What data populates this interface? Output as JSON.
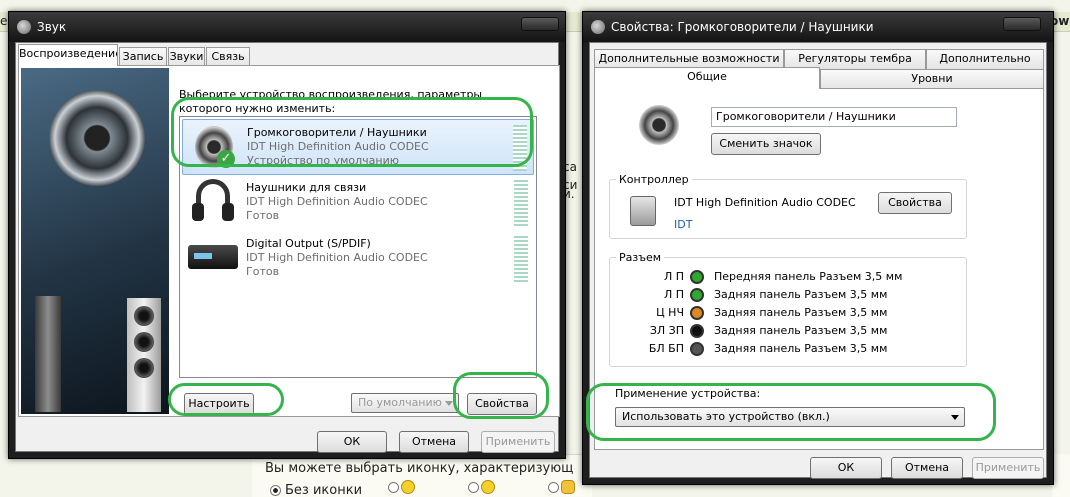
{
  "background": {
    "frag_left": "e",
    "frag_right": "ow",
    "frag_mid1": "ca",
    "frag_mid2": "си",
    "frag_mid3": "и.",
    "prompt_text": "Вы можете выбрать иконку, характеризующ",
    "radio_label": "Без иконки"
  },
  "sound_window": {
    "title": "Звук",
    "tabs": [
      "Воспроизведение",
      "Запись",
      "Звуки",
      "Связь"
    ],
    "instruction": "Выберите устройство воспроизведения, параметры которого нужно изменить:",
    "devices": [
      {
        "name": "Громкоговорители / Наушники",
        "codec": "IDT High Definition Audio CODEC",
        "status": "Устройство по умолчанию",
        "icon": "speaker-icon"
      },
      {
        "name": "Наушники для связи",
        "codec": "IDT High Definition Audio CODEC",
        "status": "Готов",
        "icon": "headset-icon"
      },
      {
        "name": "Digital Output (S/PDIF)",
        "codec": "IDT High Definition Audio CODEC",
        "status": "Готов",
        "icon": "digital-output-icon"
      }
    ],
    "configure_button": "Настроить",
    "default_select": "По умолчанию",
    "properties_button": "Свойства",
    "ok_button": "ОК",
    "cancel_button": "Отмена",
    "apply_button": "Применить"
  },
  "props_window": {
    "title": "Свойства: Громкоговорители / Наушники",
    "tabs_top": [
      "Дополнительные возможности",
      "Регуляторы тембра",
      "Дополнительно"
    ],
    "tabs_bottom": [
      "Общие",
      "Уровни"
    ],
    "device_name": "Громкоговорители / Наушники",
    "change_icon_button": "Сменить значок",
    "controller_group": "Контроллер",
    "controller_name": "IDT High Definition Audio CODEC",
    "controller_link": "IDT",
    "controller_properties_button": "Свойства",
    "jacks_group": "Разъем",
    "jacks": [
      {
        "code": "Л П",
        "label": "Передняя панель Разъем 3,5 мм",
        "color": "#2fa82f"
      },
      {
        "code": "Л П",
        "label": "Задняя панель Разъем 3,5 мм",
        "color": "#2fa82f"
      },
      {
        "code": "Ц НЧ",
        "label": "Задняя панель Разъем 3,5 мм",
        "color": "#e08a1e"
      },
      {
        "code": "ЗЛ ЗП",
        "label": "Задняя панель Разъем 3,5 мм",
        "color": "#111111"
      },
      {
        "code": "БЛ БП",
        "label": "Задняя панель Разъем 3,5 мм",
        "color": "#555555"
      }
    ],
    "usage_label": "Применение устройства:",
    "usage_value": "Использовать это устройство (вкл.)",
    "ok_button": "ОК",
    "cancel_button": "Отмена",
    "apply_button": "Применить"
  },
  "colors": {
    "highlight": "#34b44a",
    "selected_row": "#cfe4f8",
    "link": "#1f5fae"
  }
}
